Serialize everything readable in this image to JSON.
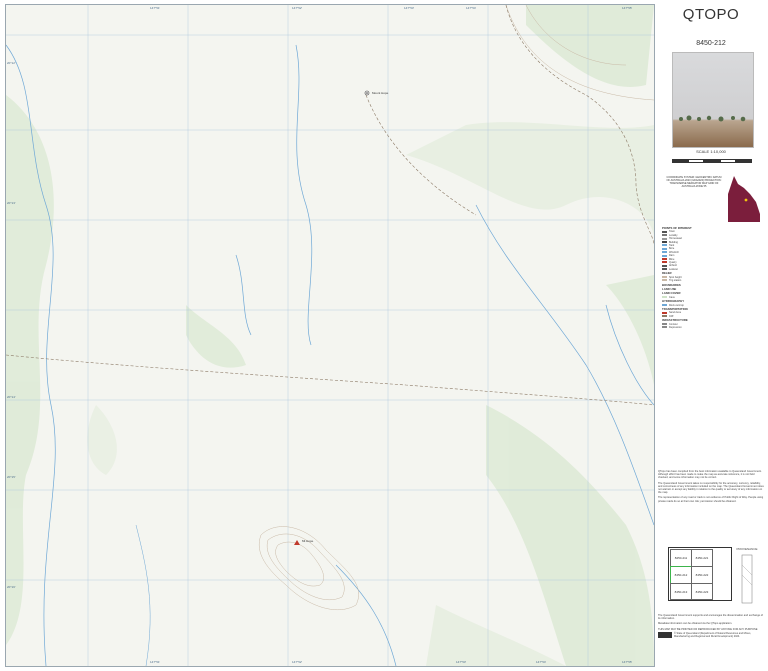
{
  "map": {
    "top_ticks": [
      "147°51'",
      "147°52'",
      "147°53'",
      "147°54'",
      "147°55'"
    ],
    "bottom_ticks": [
      "147°51'",
      "147°52'",
      "147°53'",
      "147°54'",
      "147°55'"
    ],
    "left_ticks": [
      "20°12'",
      "20°13'",
      "20°14'",
      "20°15'",
      "20°16'"
    ],
    "place_label": "Mount Hope",
    "hill_label": "Mt Hope"
  },
  "sidebar": {
    "title": "QTOPO",
    "sheet": "8450-212",
    "scale": "SCALE 1:10,000",
    "scale_ticks": [
      "0",
      "100",
      "200",
      "300",
      "400",
      "500"
    ],
    "projection": "COORDINATE SYSTEM: GEOCENTRIC DATUM OF AUSTRALIA 2020 (GDA2020) PROJECTION: TRANSVERSE MERCATOR MAP GRID OF AUSTRALIA ZONE 55",
    "legend_headings": [
      "POINTS OF INTEREST",
      "RELIEF",
      "BOUNDARIES",
      "LAND USE",
      "LAND COVER",
      "HYDROGRAPHY",
      "TRANSPORTATION",
      "INFRASTRUCTURE"
    ],
    "legend_items_a": [
      "Town",
      "Locality",
      "Homestead",
      "Building",
      "Tank",
      "Bore",
      "Windmill",
      "Dam",
      "Mine",
      "Quarry",
      "Airfield",
      "Lookout"
    ],
    "legend_items_b": [
      "Spot height",
      "Trig station",
      "Cave",
      "Rock outcrop",
      "Sand dune",
      "Cliff",
      "Contour",
      "Depression"
    ],
    "disclaimer_1": "QTopo has been compiled from the best information available to Queensland Government. Although effort has been made to make the map as accurate reference, it is not field checked, and some information may not be correct.",
    "disclaimer_2": "The Queensland Government takes no responsibility for the accuracy, currency, reliability, and correctness of any information included on the map. The Queensland Government does not warrant or accept any liability in relation to the quality or accuracy of any information on the map.",
    "disclaimer_3": "The representation of any road or track is not evidence of Public Right of Way. People using private roads do so at their own risk; permission should be obtained.",
    "index_cells": [
      "8450-211",
      "8450-221",
      "8450-212",
      "8450-222",
      "8450-213",
      "8450-223"
    ],
    "provenance": "PROVENANCE",
    "footer_1": "The Queensland Government supports and encourages the dissemination and exchange of its information.",
    "footer_2": "Metadata information can be obtained via the QTopo application.",
    "footer_3": "THIS MAP MAY BE PRINTED OR REPRODUCED BY ANYONE FOR ANY PURPOSE",
    "copyright": "© State of Queensland (Department of Natural Resources and Mines, Manufacturing and Regional and Rural Development) 2024."
  },
  "colors": {
    "contour": "#c9b9a6",
    "water": "#6fa8d6",
    "vegetation": "#cfe3c8",
    "grid": "#a9c4dc",
    "road": "#8c7a66"
  }
}
